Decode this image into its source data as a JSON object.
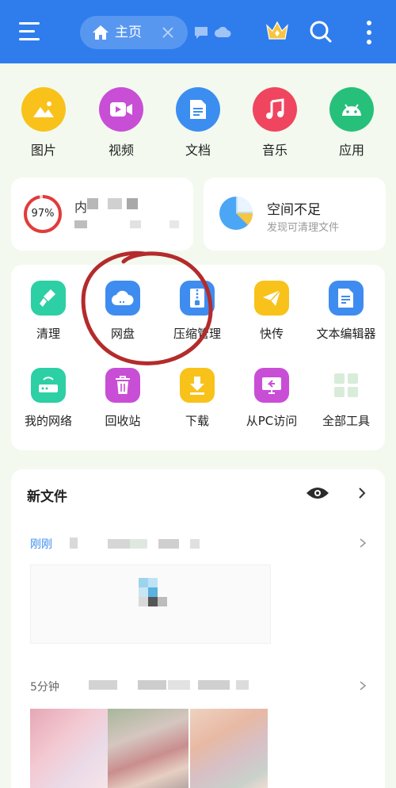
{
  "header": {
    "tab_label": "主页",
    "icons": [
      "menu-icon",
      "home-icon",
      "close-icon",
      "chat-icon",
      "cloud-icon",
      "crown-icon",
      "search-icon",
      "more-icon"
    ],
    "accent_color": "#2f7ded"
  },
  "categories": [
    {
      "label": "图片",
      "icon": "image-icon",
      "color": "#f8c21a"
    },
    {
      "label": "视频",
      "icon": "video-icon",
      "color": "#c94ed6"
    },
    {
      "label": "文档",
      "icon": "document-icon",
      "color": "#3b8ef0"
    },
    {
      "label": "音乐",
      "icon": "music-icon",
      "color": "#f0455f"
    },
    {
      "label": "应用",
      "icon": "android-icon",
      "color": "#27c07b"
    }
  ],
  "storage": {
    "percent": "97%",
    "percent_value": 0.97,
    "name_partial": "内",
    "ring_color": "#e23b3b"
  },
  "space": {
    "title": "空间不足",
    "subtitle": "发现可清理文件"
  },
  "tools": [
    {
      "label": "清理",
      "icon": "brush-icon",
      "color": "#2dcfa4"
    },
    {
      "label": "网盘",
      "icon": "cloud-drive-icon",
      "color": "#3f8cf0"
    },
    {
      "label": "压缩管理",
      "icon": "zip-icon",
      "color": "#3f8cf0"
    },
    {
      "label": "快传",
      "icon": "paper-plane-icon",
      "color": "#f8c21a"
    },
    {
      "label": "文本编辑器",
      "icon": "text-editor-icon",
      "color": "#3f8cf0"
    },
    {
      "label": "我的网络",
      "icon": "router-icon",
      "color": "#2dcfa4"
    },
    {
      "label": "回收站",
      "icon": "trash-icon",
      "color": "#c94ed6"
    },
    {
      "label": "下载",
      "icon": "download-icon",
      "color": "#f8c21a"
    },
    {
      "label": "从PC访问",
      "icon": "pc-access-icon",
      "color": "#c94ed6"
    },
    {
      "label": "全部工具",
      "icon": "grid-icon",
      "color": "#dbeedd"
    }
  ],
  "new_files": {
    "title": "新文件",
    "groups": [
      {
        "label": "刚刚"
      },
      {
        "label": "5分钟"
      }
    ]
  }
}
